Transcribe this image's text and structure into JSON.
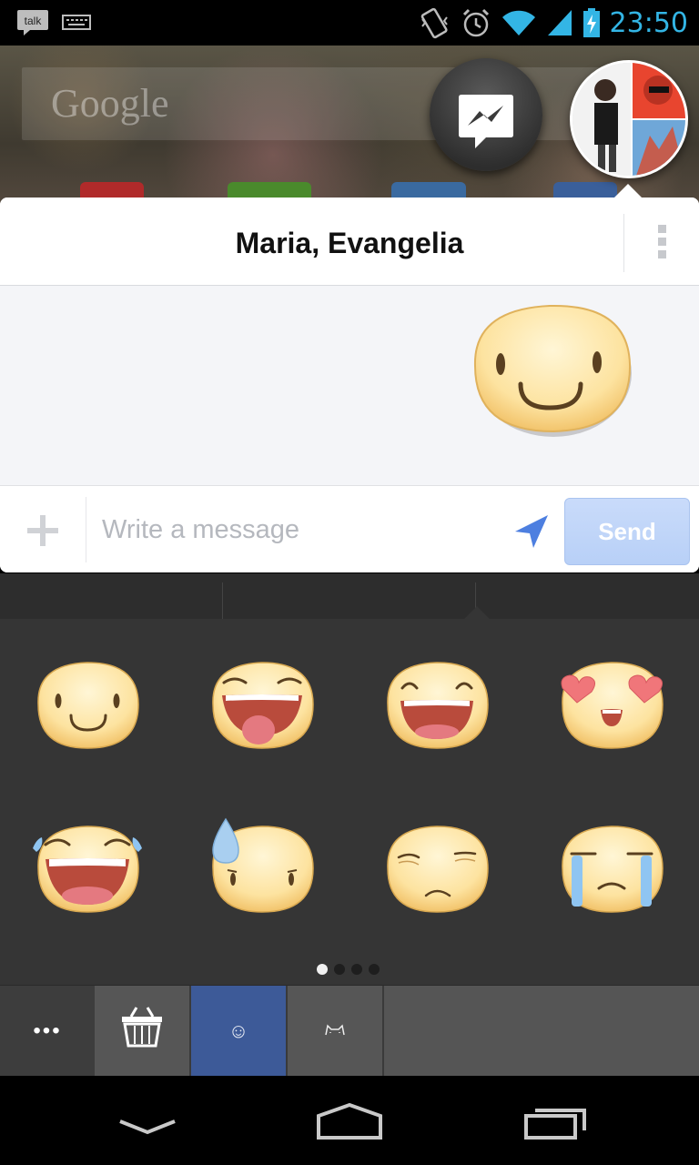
{
  "status_bar": {
    "clock": "23:50",
    "left_icons": [
      "talk-icon",
      "keyboard-icon"
    ],
    "right_icons": [
      "vibrate-icon",
      "alarm-icon",
      "wifi-icon",
      "signal-icon",
      "battery-charging-icon"
    ],
    "accent_color": "#33b5e5"
  },
  "home": {
    "google_label": "Google"
  },
  "chat_heads": {
    "messenger_icon": "messenger-bolt-icon",
    "group_avatar": "group-avatar"
  },
  "chat": {
    "title": "Maria, Evangelia",
    "menu_icon": "overflow-menu-icon",
    "sent_sticker": "smile-sticker"
  },
  "composer": {
    "plus_icon": "plus-icon",
    "placeholder": "Write a message",
    "location_icon": "location-arrow-icon",
    "send_label": "Send",
    "send_color": "#bcd2f8"
  },
  "stickers": {
    "pack": "Meep",
    "items": [
      "smile-sticker",
      "tongue-out-sticker",
      "laughing-sticker",
      "heart-eyes-sticker",
      "crying-laughing-sticker",
      "sweat-drop-sticker",
      "worried-sticker",
      "crying-sticker"
    ],
    "page_count": 4,
    "current_page": 1
  },
  "sticker_tabs": [
    {
      "name": "more-tab",
      "icon": "ellipsis-icon",
      "glyph": "•••"
    },
    {
      "name": "sticker-store-tab",
      "icon": "basket-icon",
      "glyph": ""
    },
    {
      "name": "meep-tab",
      "icon": "smiley-icon",
      "glyph": "☺",
      "active": true
    },
    {
      "name": "cat-tab",
      "icon": "cat-icon",
      "glyph": ""
    }
  ],
  "nav_bar": {
    "buttons": [
      "back-icon",
      "home-icon",
      "recent-apps-icon"
    ]
  }
}
